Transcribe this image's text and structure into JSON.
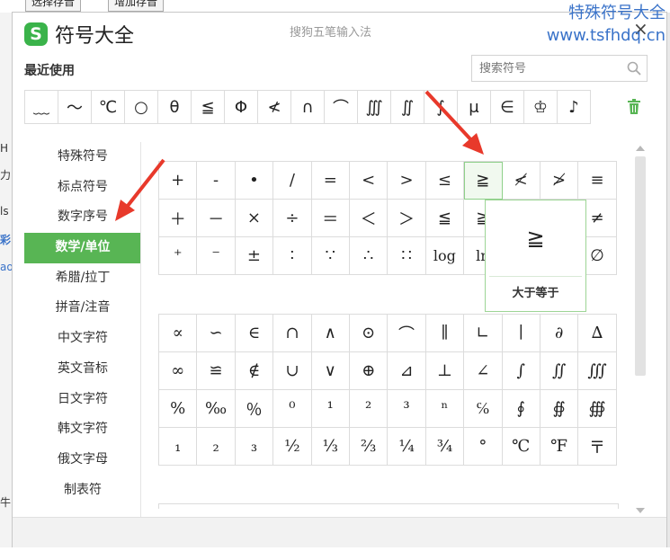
{
  "background": {
    "buttons": [
      "选择存音",
      "增加存音"
    ],
    "left_fragments": [
      "ls",
      "彩",
      "H",
      "力",
      "ao",
      "牛"
    ]
  },
  "watermark": [
    "特殊符号大全",
    "www.tsfhdq.cn"
  ],
  "dialog": {
    "logo_letter": "S",
    "title": "符号大全",
    "subtitle": "搜狗五笔输入法",
    "close_label": "×"
  },
  "recent": {
    "label": "最近使用",
    "search_placeholder": "搜索符号",
    "symbols": [
      "﹏",
      "～",
      "℃",
      "○",
      "θ",
      "≦",
      "Φ",
      "≮",
      "∩",
      "⌒",
      "∭",
      "∬",
      "∫",
      "μ",
      "∈",
      "♔",
      "♪"
    ]
  },
  "categories": [
    {
      "label": "特殊符号",
      "active": false
    },
    {
      "label": "标点符号",
      "active": false
    },
    {
      "label": "数字序号",
      "active": false
    },
    {
      "label": "数学/单位",
      "active": true
    },
    {
      "label": "希腊/拉丁",
      "active": false
    },
    {
      "label": "拼音/注音",
      "active": false
    },
    {
      "label": "中文字符",
      "active": false
    },
    {
      "label": "英文音标",
      "active": false
    },
    {
      "label": "日文字符",
      "active": false
    },
    {
      "label": "韩文字符",
      "active": false
    },
    {
      "label": "俄文字母",
      "active": false
    },
    {
      "label": "制表符",
      "active": false
    }
  ],
  "grid1": [
    "+",
    "-",
    "•",
    "/",
    "=",
    "<",
    ">",
    "≤",
    "≧",
    "≮",
    "≯",
    "≡",
    "＋",
    "－",
    "×",
    "÷",
    "＝",
    "＜",
    "＞",
    "≦",
    "≧",
    "",
    "",
    "≠",
    "⁺",
    "⁻",
    "±",
    "∶",
    "∵",
    "∴",
    "∷",
    "log",
    "ln",
    "",
    "",
    "∅"
  ],
  "grid2": [
    "∝",
    "∽",
    "∈",
    "∩",
    "∧",
    "⊙",
    "⌒",
    "∥",
    "∟",
    "∣",
    "∂",
    "∆",
    "∞",
    "≌",
    "∉",
    "∪",
    "∨",
    "⊕",
    "⊿",
    "⊥",
    "∠",
    "∫",
    "∬",
    "∭",
    "%",
    "‰",
    "％",
    "⁰",
    "¹",
    "²",
    "³",
    "ⁿ",
    "℅",
    "∮",
    "∯",
    "∰",
    "₁",
    "₂",
    "₃",
    "½",
    "⅓",
    "⅔",
    "¼",
    "¾",
    "°",
    "℃",
    "℉",
    "〒"
  ],
  "preview": {
    "symbol": "≧",
    "name": "大于等于"
  },
  "colors": {
    "accent": "#58b554",
    "watermark": "#3a73c9",
    "arrow": "#e8392b"
  }
}
